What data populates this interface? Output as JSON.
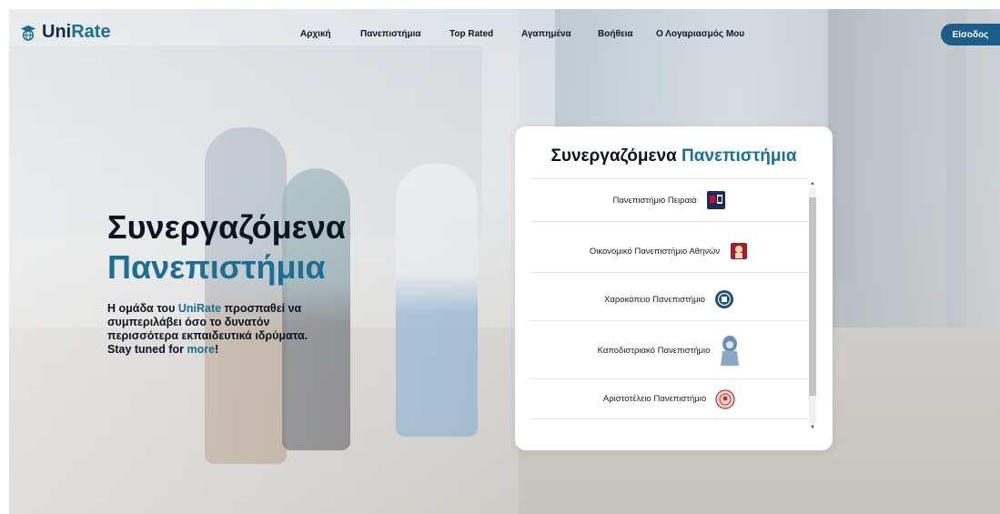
{
  "brand": {
    "name_part1": "Uni",
    "name_part2": "Rate"
  },
  "nav": {
    "links": [
      "Αρχική",
      "Πανεπιστήμια",
      "Top Rated",
      "Αγαπημένα",
      "Βοήθεια",
      "Ο Λογαριασμός Μου"
    ],
    "login_label": "Είσοδος"
  },
  "hero": {
    "title_line1": "Συνεργαζόμενα",
    "title_line2": "Πανεπιστήμια",
    "desc_part1": "Η ομάδα του ",
    "desc_uni": "Uni",
    "desc_rate": "Rate",
    "desc_part2": " προσπαθεί να συμπεριλάβει όσο το δυνατόν περισσότερα εκπαιδευτικά ιδρύματα. Stay tuned for ",
    "desc_more": "more",
    "desc_end": "!"
  },
  "card": {
    "title_part1": "Συνεργαζόμενα ",
    "title_part2": "Πανεπιστήμια",
    "universities": [
      {
        "name": "Πανεπιστήμιο Πειραιά",
        "icon": "piraeus-logo-icon"
      },
      {
        "name": "Οικονομικό Πανεπιστήμιο Αθηνών",
        "icon": "aueb-logo-icon"
      },
      {
        "name": "Χαροκόπειο Πανεπιστήμιο",
        "icon": "harokopio-logo-icon"
      },
      {
        "name": "Καποδιστριακό Πανεπιστήμιο",
        "icon": "uoa-logo-icon"
      },
      {
        "name": "Αριστοτέλειο Πανεπιστήμιο",
        "icon": "auth-logo-icon"
      }
    ]
  },
  "colors": {
    "accent": "#1a6f94",
    "dark": "#0b1420",
    "button": "#1b5e8a"
  }
}
